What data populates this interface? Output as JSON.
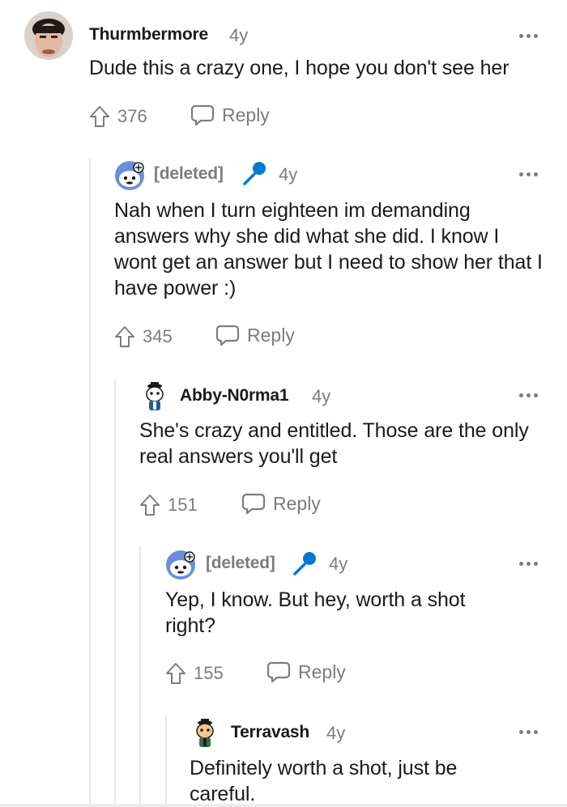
{
  "comments": [
    {
      "author": "Thurmbermore",
      "time": "4y",
      "body": "Dude this a crazy one, I hope you don't see her",
      "votes": "376",
      "reply_label": "Reply"
    },
    {
      "author": "[deleted]",
      "time": "4y",
      "body": "Nah when I turn eighteen im demanding answers why she did what she did. I know I wont get an answer but I need to show her that I have power :)",
      "votes": "345",
      "reply_label": "Reply"
    },
    {
      "author": "Abby-N0rma1",
      "time": "4y",
      "body": "She's crazy and entitled. Those are the only real answers you'll get",
      "votes": "151",
      "reply_label": "Reply"
    },
    {
      "author": "[deleted]",
      "time": "4y",
      "body": "Yep, I know. But hey, worth a shot right?",
      "votes": "155",
      "reply_label": "Reply"
    },
    {
      "author": "Terravash",
      "time": "4y",
      "body": "Definitely worth a shot, just be careful.",
      "votes": "",
      "reply_label": ""
    }
  ],
  "colors": {
    "text": "#1a1a1b",
    "meta": "#7c7c7c",
    "thread_line": "#e3e6e8",
    "mic_blue": "#0079d3"
  },
  "icons": [
    "upvote-icon",
    "reply-icon",
    "more-options-icon",
    "microphone-award-icon",
    "avatar"
  ]
}
